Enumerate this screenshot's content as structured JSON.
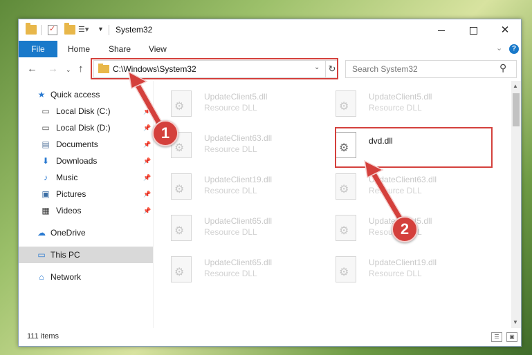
{
  "titlebar": {
    "title": "System32"
  },
  "ribbon": {
    "file": "File",
    "home": "Home",
    "share": "Share",
    "view": "View"
  },
  "address": {
    "path": "C:\\Windows\\System32"
  },
  "search": {
    "placeholder": "Search System32"
  },
  "sidebar": {
    "items": [
      {
        "label": "Quick access",
        "icon": "star-icon"
      },
      {
        "label": "Local Disk (C:)",
        "icon": "disk-icon"
      },
      {
        "label": "Local Disk (D:)",
        "icon": "disk-icon"
      },
      {
        "label": "Documents",
        "icon": "documents-icon"
      },
      {
        "label": "Downloads",
        "icon": "download-icon"
      },
      {
        "label": "Music",
        "icon": "music-icon"
      },
      {
        "label": "Pictures",
        "icon": "pictures-icon"
      },
      {
        "label": "Videos",
        "icon": "videos-icon"
      },
      {
        "label": "OneDrive",
        "icon": "cloud-icon"
      },
      {
        "label": "This PC",
        "icon": "computer-icon"
      },
      {
        "label": "Network",
        "icon": "network-icon"
      }
    ]
  },
  "files": [
    {
      "name": "UpdateClient5.dll",
      "type": "Resource DLL"
    },
    {
      "name": "UpdateClient5.dll",
      "type": "Resource DLL"
    },
    {
      "name": "UpdateClient63.dll",
      "type": "Resource DLL"
    },
    {
      "name": "dvd.dll",
      "type": ""
    },
    {
      "name": "UpdateClient19.dll",
      "type": "Resource DLL"
    },
    {
      "name": "UpdateClient63.dll",
      "type": "Resource DLL"
    },
    {
      "name": "UpdateClient65.dll",
      "type": "Resource DLL"
    },
    {
      "name": "UpdateClient5.dll",
      "type": "Resource DLL"
    },
    {
      "name": "UpdateClient65.dll",
      "type": "Resource DLL"
    },
    {
      "name": "UpdateClient19.dll",
      "type": "Resource DLL"
    }
  ],
  "status": {
    "items": "111 items"
  },
  "annotations": {
    "step1": "1",
    "step2": "2",
    "color": "#d4403c"
  }
}
